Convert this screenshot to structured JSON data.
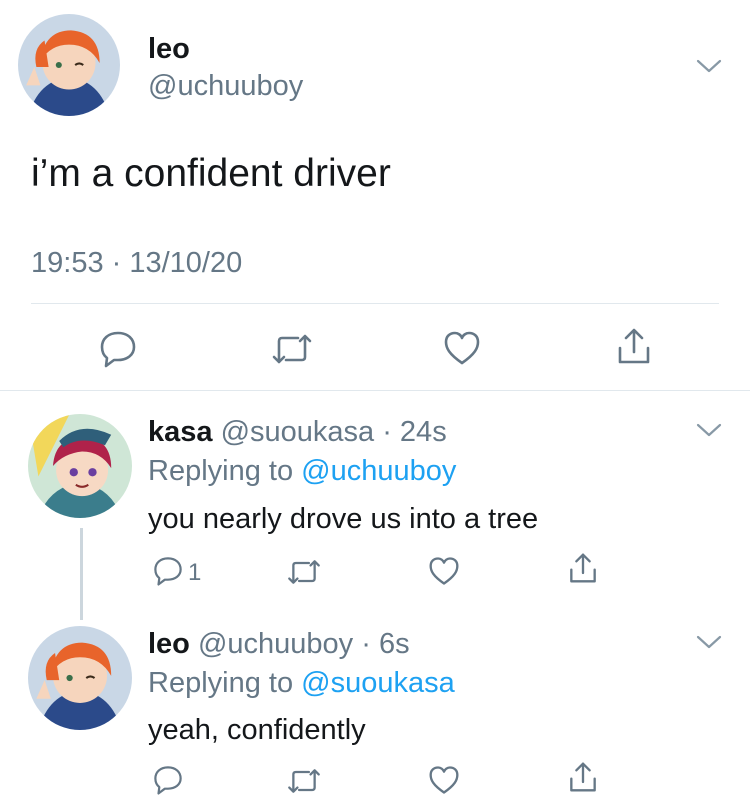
{
  "main_tweet": {
    "display_name": "leo",
    "handle": "@uchuuboy",
    "text": "i’m a confident driver",
    "timestamp": "19:53 · 13/10/20"
  },
  "replies": [
    {
      "display_name": "kasa",
      "handle_time": "@suoukasa · 24s",
      "replying_prefix": "Replying to ",
      "replying_to": "@uchuuboy",
      "text": "you nearly drove us into a tree",
      "reply_count": "1"
    },
    {
      "display_name": "leo",
      "handle_time": "@uchuuboy · 6s",
      "replying_prefix": "Replying to ",
      "replying_to": "@suoukasa",
      "text": "yeah, confidently",
      "reply_count": ""
    }
  ],
  "colors": {
    "text": "#14171a",
    "muted": "#657786",
    "link": "#1da1f2",
    "icon": "#657786",
    "divider": "#e1e8ed"
  }
}
